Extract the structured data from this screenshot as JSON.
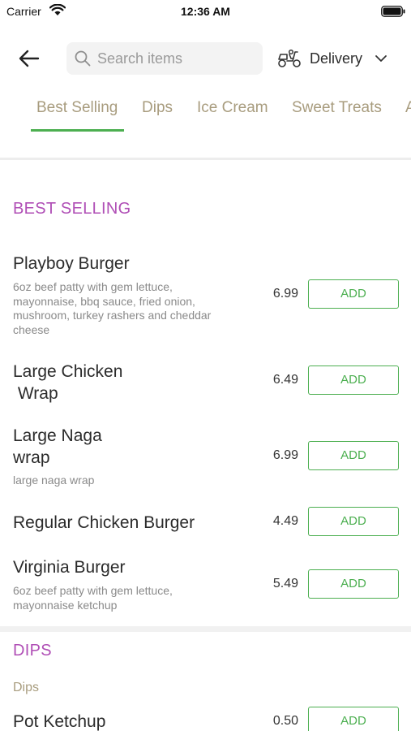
{
  "status_bar": {
    "carrier": "Carrier",
    "time": "12:36 AM"
  },
  "header": {
    "search_placeholder": "Search items",
    "delivery_label": "Delivery"
  },
  "tabs": [
    {
      "label": "Best Selling",
      "active": true
    },
    {
      "label": "Dips",
      "active": false
    },
    {
      "label": "Ice Cream",
      "active": false
    },
    {
      "label": "Sweet Treats",
      "active": false
    },
    {
      "label": "A",
      "active": false
    }
  ],
  "colors": {
    "accent_green": "#4caf50",
    "section_purple": "#b04fb6",
    "tab_gold": "#a89c7e"
  },
  "best_selling": {
    "title": "BEST SELLING",
    "items": [
      {
        "name_lines": [
          "Playboy Burger"
        ],
        "desc_lines": [
          "6oz beef patty with gem lettuce,",
          "mayonnaise, bbq sauce, fried onion,",
          "mushroom, turkey rashers and cheddar",
          "cheese"
        ],
        "price": "6.99",
        "button": "ADD"
      },
      {
        "name_lines": [
          "Large Chicken",
          " Wrap"
        ],
        "desc_lines": [],
        "price": "6.49",
        "button": "ADD"
      },
      {
        "name_lines": [
          "Large Naga",
          "wrap"
        ],
        "desc_lines": [
          "large naga wrap"
        ],
        "price": "6.99",
        "button": "ADD"
      },
      {
        "name_lines": [
          "Regular Chicken Burger"
        ],
        "desc_lines": [],
        "price": "4.49",
        "button": "ADD"
      },
      {
        "name_lines": [
          "Virginia Burger"
        ],
        "desc_lines": [
          "6oz beef patty with gem lettuce,",
          "mayonnaise ketchup"
        ],
        "price": "5.49",
        "button": "ADD"
      }
    ]
  },
  "dips": {
    "title": "DIPS",
    "subcategory": "Dips",
    "items": [
      {
        "name": "Pot Ketchup",
        "price": "0.50",
        "button": "ADD"
      }
    ]
  }
}
